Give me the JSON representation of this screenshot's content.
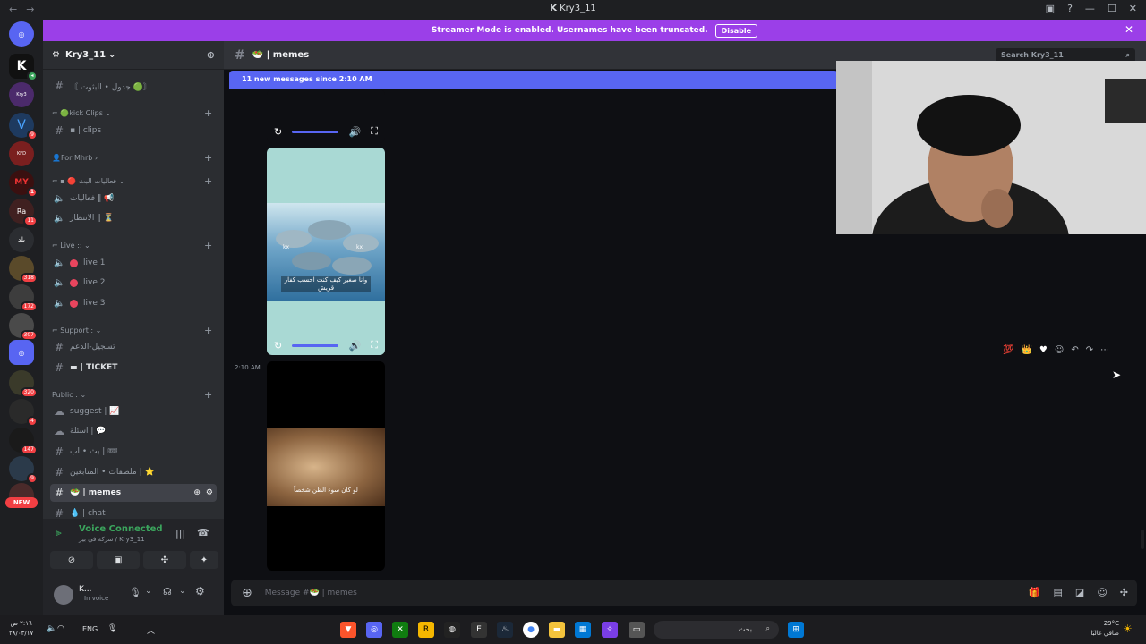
{
  "window": {
    "title": "Kry3_11"
  },
  "banner": {
    "text": "Streamer Mode is enabled. Usernames have been truncated.",
    "disable_label": "Disable"
  },
  "server": {
    "name": "Kry3_11"
  },
  "channels": {
    "top_channel": "〘 جدول • البثوت 🟢〙",
    "cat_kick": "⌐ 🟢kick Clips ⌄",
    "clips": "▪ | clips",
    "cat_mhrb": "👤For Mhrb ›",
    "cat_events": "⌐ ▪ 🔴 فعاليات البث ⌄",
    "events1": "فعاليات ‖ 📢",
    "events2": "الانتظار ‖ ⏳",
    "cat_live": "⌐ Live :: ⌄",
    "live1": "live 1",
    "live2": "live 2",
    "live3": "live 3",
    "cat_support": "⌐ Support : ⌄",
    "support1": "تسجيل-الدعم",
    "ticket": "▬ | TICKET",
    "cat_public": "Public : ⌄",
    "suggest": "suggest | 📈",
    "questions": "اسئلة | 💬",
    "stream": "بث • اب | 🎟",
    "stickers": "ملصقات • المتابعين | ⭐",
    "memes": "🥗 | memes",
    "chat": "💧 | chat"
  },
  "voice": {
    "status": "Voice Connected",
    "sub": "سركة في بيز / Kry3_11"
  },
  "user": {
    "name": "K...",
    "status": "In voice"
  },
  "channel_header": {
    "name": "🥗 | memes",
    "search_placeholder": "Search Kry3_11"
  },
  "chat": {
    "new_messages": "11 new messages since 2:10 AM",
    "timestamp": "2:10 AM",
    "meme1_caption": "وانا صغير كيف كنت احسب كفار قريش",
    "meme1_tag_left": "kx",
    "meme1_tag_right": "kx",
    "meme2_caption": "لو كان سوء الظن شخصاً"
  },
  "composer": {
    "placeholder": "Message #🥗 | memes"
  },
  "guild_badges": [
    "9",
    "1",
    "11",
    "318",
    "172",
    "307",
    "320",
    "4",
    "147",
    "9"
  ],
  "guild_labels": {
    "kfd": "KFD",
    "my": "MY",
    "rate": "Ra",
    "bld": "بلد",
    "new": "NEW"
  },
  "taskbar": {
    "time": "٢:١٦ ص",
    "date": "٢٨/٠٣/١٧",
    "lang": "ENG",
    "search": "بحث",
    "weather_temp": "29°C",
    "weather_desc": "صافي غالبًا"
  }
}
